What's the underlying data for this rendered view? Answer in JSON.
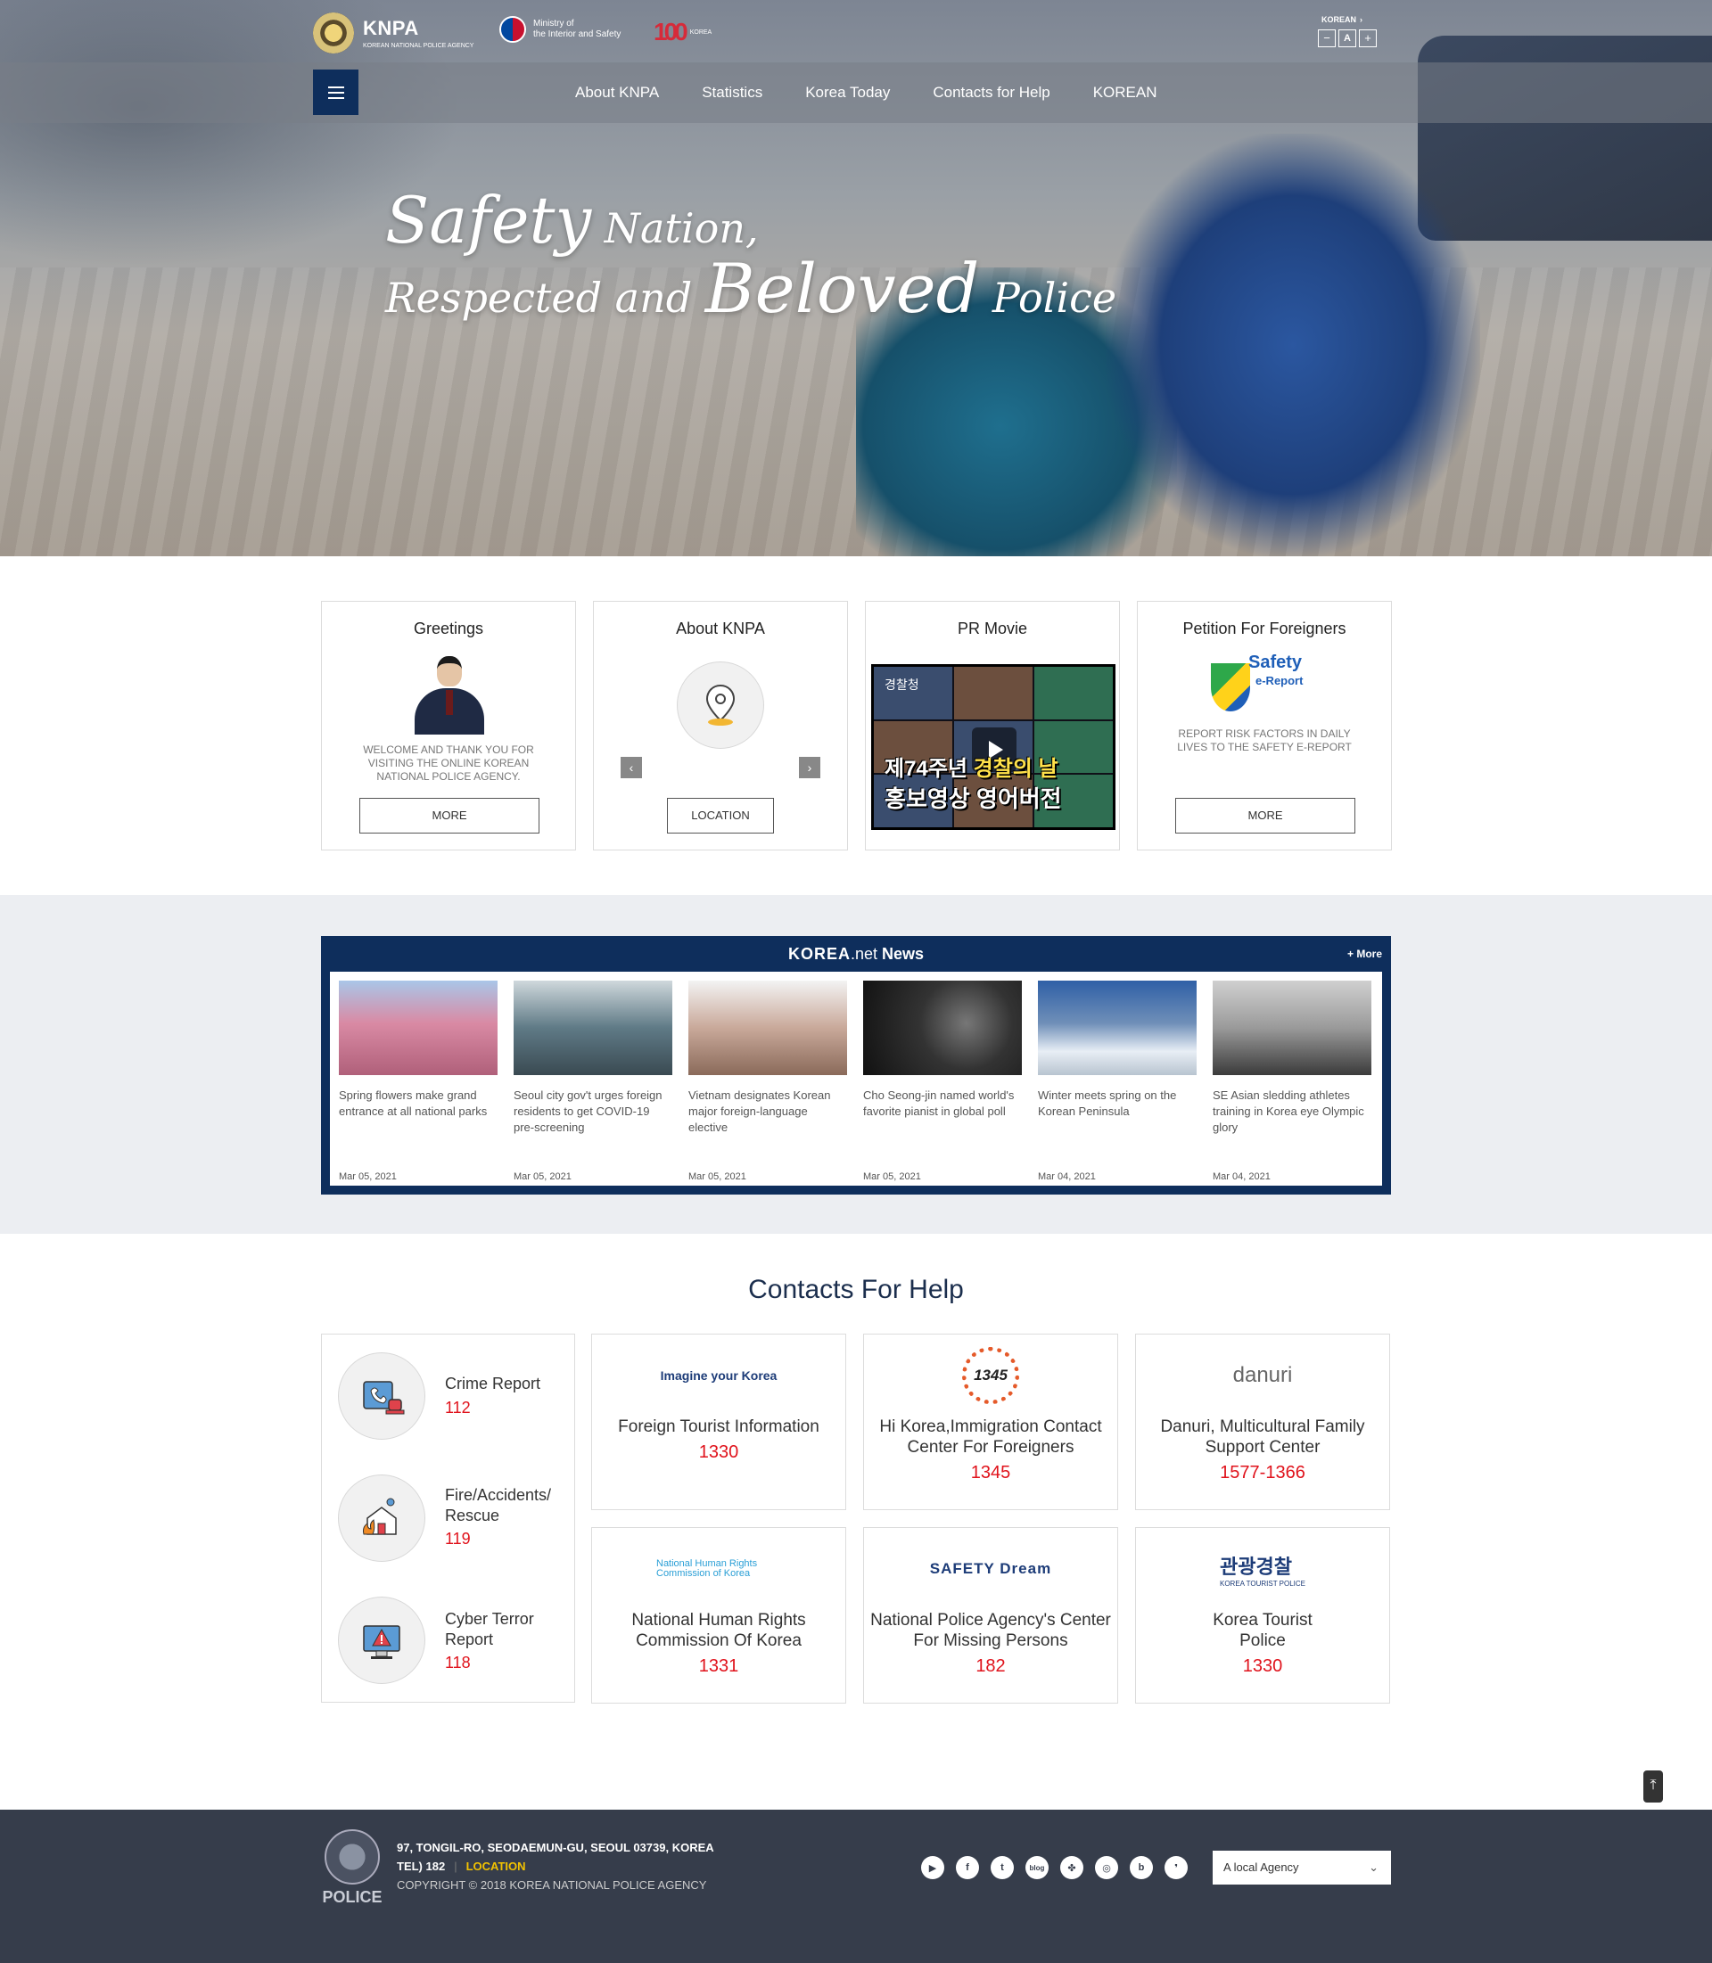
{
  "header": {
    "logo_title": "KNPA",
    "logo_subtitle": "KOREAN NATIONAL POLICE AGENCY",
    "ministry_line1": "Ministry of",
    "ministry_line2": "the Interior and Safety",
    "anniversary_number": "100",
    "anniversary_sub": "KOREA",
    "language": "KOREAN",
    "font_minus": "−",
    "font_reset": "A",
    "font_plus": "+",
    "nav": [
      "About KNPA",
      "Statistics",
      "Korea Today",
      "Contacts for Help",
      "KOREAN"
    ]
  },
  "hero": {
    "line1_big": "Safety",
    "line1_small": " Nation,",
    "line2_small1": "Respected and ",
    "line2_big": "Beloved",
    "line2_small2": " Police"
  },
  "cards": [
    {
      "title": "Greetings",
      "desc": "Welcome and thank you for visiting the online Korean National Police Agency.",
      "button": "MORE"
    },
    {
      "title": "About KNPA",
      "button": "LOCATION",
      "prev": "‹",
      "next": "›"
    },
    {
      "title": "PR Movie",
      "video_logo": "경찰청",
      "video_line1_pre": "제74주년 ",
      "video_line1_hl": "경찰의 날",
      "video_line2": "홍보영상 영어버전"
    },
    {
      "title": "Petition For Foreigners",
      "logo_main": "Safety",
      "logo_sub": "e-Report",
      "desc": "Report risk factors in daily lives to the Safety e-Report",
      "button": "MORE"
    }
  ],
  "news": {
    "brand_k": "KOREA",
    "brand_net": ".net",
    "brand_news": " News",
    "more": "+ More",
    "items": [
      {
        "caption": "Spring flowers make grand entrance at all national parks",
        "date": "Mar 05, 2021",
        "color": "#d98aa4"
      },
      {
        "caption": "Seoul city gov't urges foreign residents to get COVID-19 pre-screening",
        "date": "Mar 05, 2021",
        "color": "#5f7a86"
      },
      {
        "caption": "Vietnam designates Korean major foreign-language elective",
        "date": "Mar 05, 2021",
        "color": "#c9a99a"
      },
      {
        "caption": "Cho Seong-jin named world's favorite pianist in global poll",
        "date": "Mar 05, 2021",
        "color": "#444444"
      },
      {
        "caption": "Winter meets spring on the Korean Peninsula",
        "date": "Mar 04, 2021",
        "color": "#6f8fb8"
      },
      {
        "caption": "SE Asian sledding athletes training in Korea eye Olympic glory",
        "date": "Mar 04, 2021",
        "color": "#9a9a9a"
      }
    ]
  },
  "contacts": {
    "title": "Contacts For Help",
    "emergency": [
      {
        "label": "Crime Report",
        "number": "112",
        "icon": "phone-alarm-icon"
      },
      {
        "label": "Fire/Accidents/ Rescue",
        "number": "119",
        "icon": "house-fire-icon"
      },
      {
        "label": "Cyber Terror Report",
        "number": "118",
        "icon": "monitor-alert-icon"
      }
    ],
    "help": [
      {
        "logo": "Imagine your Korea",
        "name": "Foreign Tourist Information",
        "phone": "1330"
      },
      {
        "logo": "1345",
        "name": "Hi Korea,Immigration Contact Center For Foreigners",
        "phone": "1345"
      },
      {
        "logo": "danuri",
        "name": "Danuri, Multicultural Family Support Center",
        "phone": "1577-1366"
      },
      {
        "logo": "National Human Rights Commission of Korea",
        "name": "National Human Rights Commission Of Korea",
        "phone": "1331"
      },
      {
        "logo": "SAFETY Dream",
        "name": "National Police Agency's Center For Missing Persons",
        "phone": "182"
      },
      {
        "logo": "관광경찰",
        "logo_sub": "KOREA TOURIST POLICE",
        "name": "Korea Tourist Police",
        "phone": "1330"
      }
    ]
  },
  "top_button": "⤒",
  "footer": {
    "logo_text": "POLICE",
    "address": "97, TONGIL-RO, SEODAEMUN-GU, SEOUL 03739, KOREA",
    "tel": "TEL) 182",
    "location": "LOCATION",
    "copyright": "COPYRIGHT © 2018 KOREA NATIONAL POLICE AGENCY",
    "social": [
      "▶",
      "f",
      "t",
      "blog",
      "✤",
      "◎",
      "b",
      "❜"
    ],
    "agency_select": "A local Agency"
  }
}
